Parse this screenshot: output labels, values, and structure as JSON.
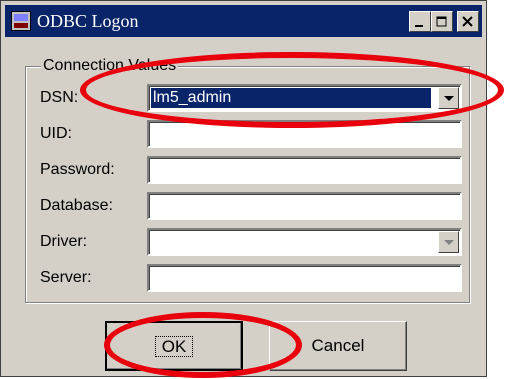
{
  "window": {
    "title": "ODBC Logon",
    "controls": {
      "minimize": "_",
      "maximize": "□",
      "close": "×"
    }
  },
  "group": {
    "legend": "Connection Values"
  },
  "fields": [
    {
      "label": "DSN:",
      "value": "lm5_admin",
      "type": "dropdown"
    },
    {
      "label": "UID:",
      "value": "",
      "type": "text"
    },
    {
      "label": "Password:",
      "value": "",
      "type": "text"
    },
    {
      "label": "Database:",
      "value": "",
      "type": "text"
    },
    {
      "label": "Driver:",
      "value": "",
      "type": "dropdown",
      "disabled": true
    },
    {
      "label": "Server:",
      "value": "",
      "type": "text"
    }
  ],
  "buttons": {
    "ok": "OK",
    "cancel": "Cancel"
  },
  "colors": {
    "title_bar": "#0a246a",
    "face": "#d4d0c8",
    "annotation": "#e8000c"
  },
  "icons": [
    "odbc-app-icon",
    "minimize-icon",
    "maximize-icon",
    "close-icon",
    "dropdown-arrow-icon"
  ]
}
